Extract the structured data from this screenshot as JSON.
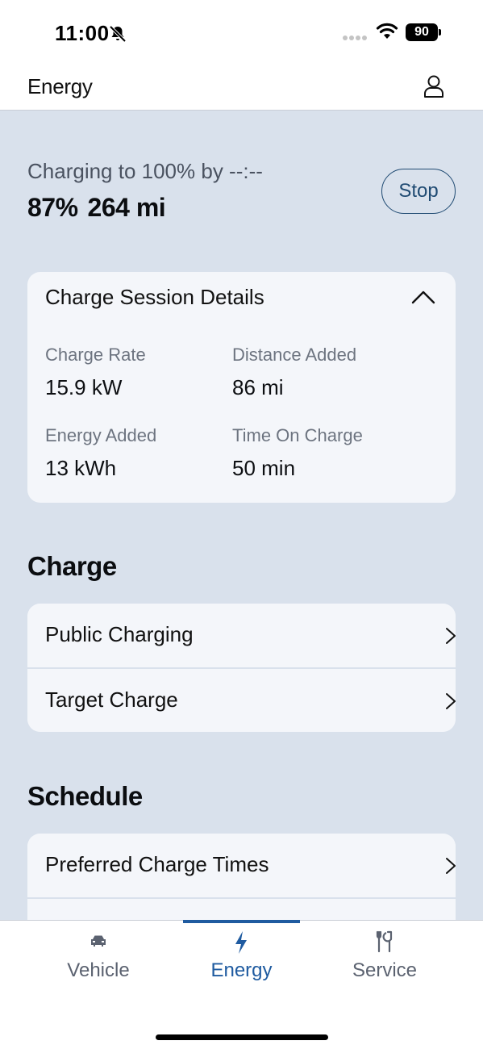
{
  "status_bar": {
    "time": "11:00",
    "battery_level": "90",
    "icons": [
      "bell-slash-icon",
      "signal-icon",
      "wifi-icon",
      "battery-icon"
    ]
  },
  "header": {
    "title": "Energy",
    "profile_icon": "person-icon"
  },
  "charging": {
    "status_text": "Charging to 100% by --:--",
    "percent": "87%",
    "range": "264 mi",
    "stop_label": "Stop"
  },
  "session": {
    "title": "Charge Session Details",
    "details": [
      {
        "label": "Charge Rate",
        "value": "15.9 kW"
      },
      {
        "label": "Distance Added",
        "value": "86 mi"
      },
      {
        "label": "Energy Added",
        "value": "13 kWh"
      },
      {
        "label": "Time On Charge",
        "value": "50 min"
      }
    ]
  },
  "charge_section": {
    "heading": "Charge",
    "items": [
      {
        "label": "Public Charging"
      },
      {
        "label": "Target Charge"
      }
    ]
  },
  "schedule_section": {
    "heading": "Schedule",
    "items": [
      {
        "label": "Preferred Charge Times"
      }
    ]
  },
  "tabs": [
    {
      "label": "Vehicle",
      "icon": "car-icon",
      "active": false
    },
    {
      "label": "Energy",
      "icon": "lightning-bolt-icon",
      "active": true
    },
    {
      "label": "Service",
      "icon": "tools-icon",
      "active": false
    }
  ],
  "colors": {
    "accent": "#1f5ba0",
    "background": "#d9e1ec",
    "card": "#f4f6fa",
    "inactive_tab": "#5b6270"
  }
}
